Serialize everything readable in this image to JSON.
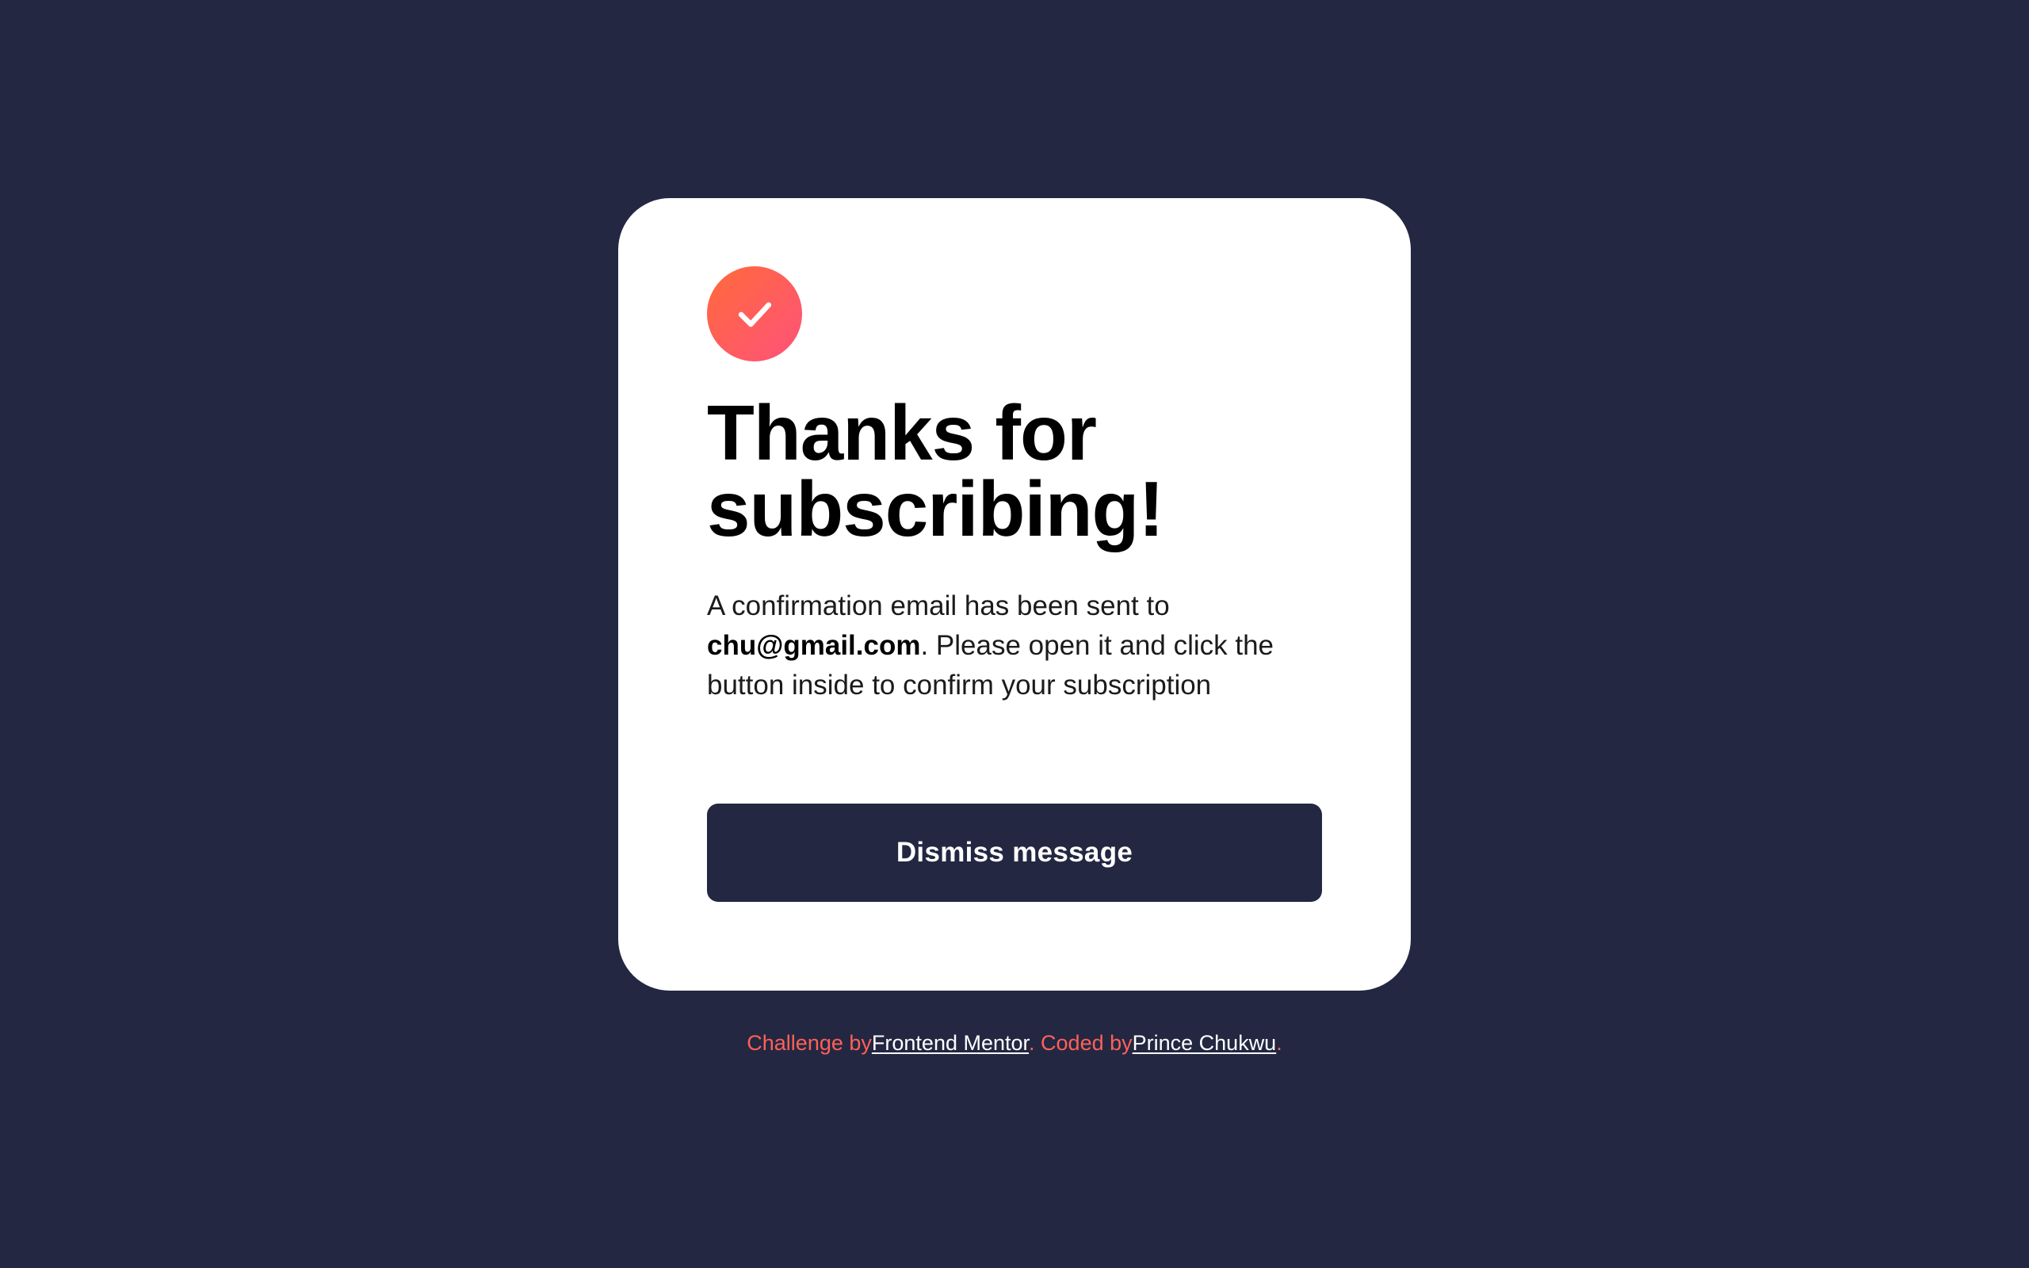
{
  "colors": {
    "background": "#232742",
    "card": "#ffffff",
    "accent": "#ff5b64",
    "accent_gradient_start": "#ff6a3a",
    "accent_gradient_end": "#ff527b",
    "button": "#232742",
    "button_text": "#ffffff",
    "footer_text": "#ff6156",
    "footer_link": "#ffffff"
  },
  "icon": {
    "name": "checkmark-circle-icon",
    "glyph": "check"
  },
  "card": {
    "title": "Thanks for subscribing!",
    "message_prefix": "A confirmation email has been sent to",
    "email": "chu@gmail.com",
    "message_suffix": ". Please open it and click the button inside to confirm your subscription",
    "dismiss_label": "Dismiss message"
  },
  "footer": {
    "challenge_by": "Challenge by",
    "frontend_mentor": "Frontend Mentor",
    "coded_by": ". Coded by",
    "author": "Prince Chukwu",
    "period": "."
  }
}
